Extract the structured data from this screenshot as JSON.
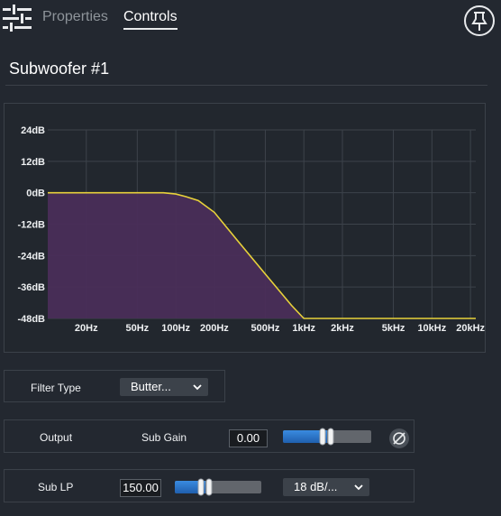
{
  "tabs": {
    "properties": "Properties",
    "controls": "Controls"
  },
  "icons": {
    "menu": "sliders-icon",
    "pin": "pin-icon",
    "phase": "phase-invert-icon",
    "dropdown": "chevron-down-icon"
  },
  "device": {
    "title": "Subwoofer #1"
  },
  "colors": {
    "accent": "#2f79cf",
    "curve": "#e8d23a",
    "fill": "#4a2d58",
    "grid": "#3d434b"
  },
  "chart_data": {
    "type": "area",
    "x_scale": "log",
    "y_ticks": [
      "24dB",
      "12dB",
      "0dB",
      "-12dB",
      "-24dB",
      "-36dB",
      "-48dB"
    ],
    "x_ticks": [
      "20Hz",
      "50Hz",
      "100Hz",
      "200Hz",
      "500Hz",
      "1kHz",
      "2kHz",
      "5kHz",
      "10kHz",
      "20kHz"
    ],
    "xlim": [
      10,
      22000
    ],
    "ylim": [
      -48,
      24
    ],
    "grid": true,
    "series": [
      {
        "x": [
          10,
          20,
          50,
          80,
          100,
          120,
          150,
          200,
          300,
          500,
          800,
          1000,
          2000,
          5000,
          10000,
          22000
        ],
        "y": [
          0,
          0,
          0,
          0,
          -0.5,
          -1.5,
          -3,
          -7.5,
          -18,
          -31,
          -43,
          -48,
          -48,
          -48,
          -48,
          -48
        ]
      }
    ]
  },
  "filter": {
    "label": "Filter Type",
    "value": "Butter..."
  },
  "output": {
    "label": "Output",
    "gain_label": "Sub Gain",
    "gain_value": "0.00",
    "gain_slider_fraction": 0.5
  },
  "sub_lp": {
    "label": "Sub LP",
    "value": "150.00",
    "slider_fraction": 0.35,
    "slope": "18 dB/..."
  }
}
